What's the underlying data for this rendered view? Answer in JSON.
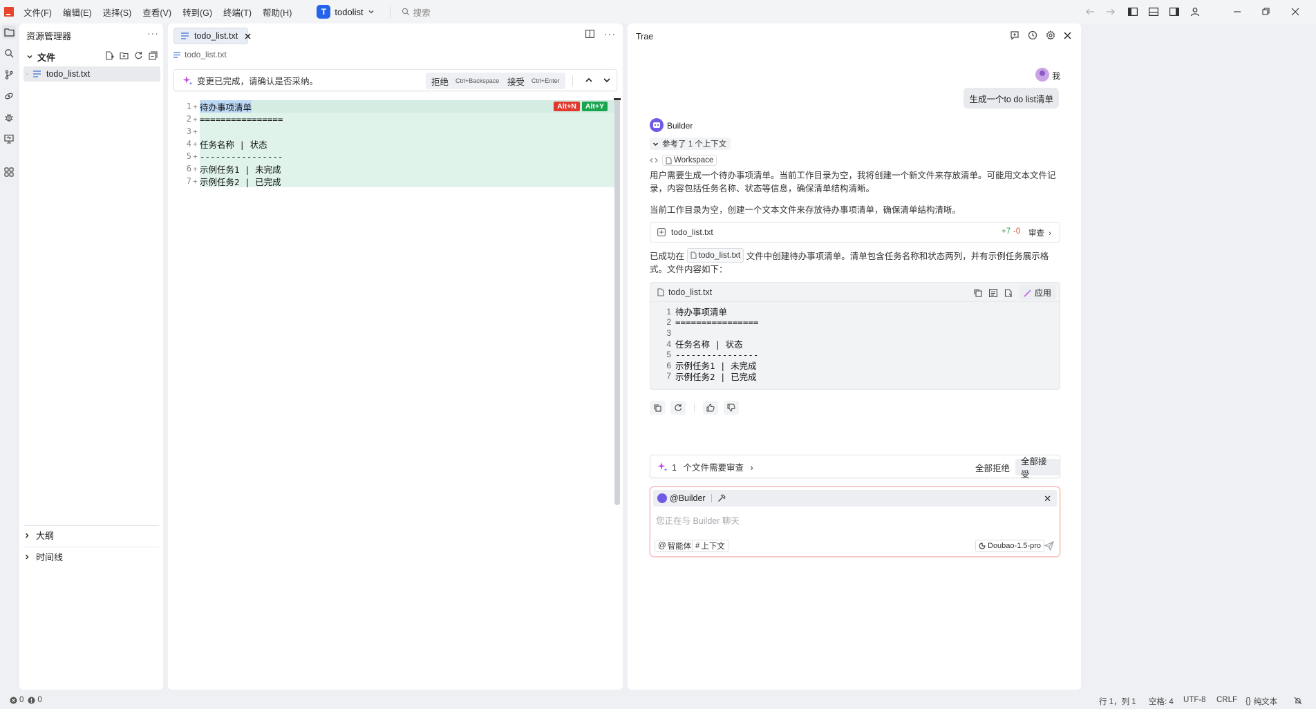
{
  "titlebar": {
    "menu": [
      "文件(F)",
      "编辑(E)",
      "选择(S)",
      "查看(V)",
      "转到(G)",
      "终端(T)",
      "帮助(H)"
    ],
    "project_initial": "T",
    "project_name": "todolist",
    "search_placeholder": "搜索"
  },
  "explorer": {
    "title": "资源管理器",
    "more": "···",
    "folder_label": "文件",
    "files": [
      "todo_list.txt"
    ],
    "sections": [
      "大纲",
      "时间线"
    ]
  },
  "editor": {
    "tab_label": "todo_list.txt",
    "breadcrumb": "todo_list.txt",
    "review": {
      "message": "变更已完成，请确认是否采纳。",
      "reject_label": "拒绝",
      "reject_shortcut": "Ctrl+Backspace",
      "accept_label": "接受",
      "accept_shortcut": "Ctrl+Enter"
    },
    "key_hints": {
      "reject": "Alt+N",
      "accept": "Alt+Y",
      "reject_color": "#e03a2f",
      "accept_color": "#19a550"
    },
    "lines": [
      {
        "num": "1",
        "text": "待办事项清单"
      },
      {
        "num": "2",
        "text": "================"
      },
      {
        "num": "3",
        "text": ""
      },
      {
        "num": "4",
        "text": "任务名称 | 状态"
      },
      {
        "num": "5",
        "text": "----------------"
      },
      {
        "num": "6",
        "text": "示例任务1 | 未完成"
      },
      {
        "num": "7",
        "text": "示例任务2 | 已完成"
      }
    ],
    "added_line_color": "#dff3ea"
  },
  "chat": {
    "title": "Trae",
    "user_name": "我",
    "user_message": "生成一个to do list清单",
    "bot_name": "Builder",
    "context_ref": "参考了 1 个上下文",
    "workspace_label": "Workspace",
    "para1": "用户需要生成一个待办事项清单。当前工作目录为空，我将创建一个新文件来存放清单。可能用文本文件记录，内容包括任务名称、状态等信息，确保清单结构清晰。",
    "para2": "当前工作目录为空，创建一个文本文件来存放待办事项清单，确保清单结构清晰。",
    "file_change": {
      "name": "todo_list.txt",
      "added": "+7",
      "removed": "-0",
      "review_label": "审查"
    },
    "para3_prefix": "已成功在",
    "para3_file": "todo_list.txt",
    "para3_suffix": "文件中创建待办事项清单。清单包含任务名称和状态两列，并有示例任务展示格式。文件内容如下：",
    "code_block": {
      "file_name": "todo_list.txt",
      "apply_label": "应用",
      "lines": [
        {
          "num": "1",
          "text": "待办事项清单"
        },
        {
          "num": "2",
          "text": "================"
        },
        {
          "num": "3",
          "text": ""
        },
        {
          "num": "4",
          "text": "任务名称 | 状态"
        },
        {
          "num": "5",
          "text": "----------------"
        },
        {
          "num": "6",
          "text": "示例任务1 | 未完成"
        },
        {
          "num": "7",
          "text": "示例任务2 | 已完成"
        }
      ]
    },
    "review_summary": {
      "count": "1",
      "text": "个文件需要审查",
      "reject_all": "全部拒绝",
      "accept_all": "全部接受"
    },
    "input": {
      "agent": "@Builder",
      "placeholder": "您正在与 Builder 聊天",
      "chip_agent": "智能体",
      "chip_context": "上下文",
      "model": "Doubao-1.5-pro"
    }
  },
  "statusbar": {
    "errors": "0",
    "warnings": "0",
    "position": "行 1，列 1",
    "spaces": "空格: 4",
    "encoding": "UTF-8",
    "eol": "CRLF",
    "language": "纯文本"
  }
}
